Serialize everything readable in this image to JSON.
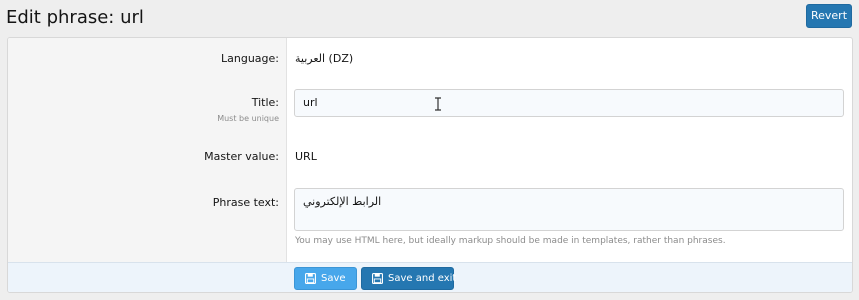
{
  "header": {
    "title": "Edit phrase: url",
    "revert_label": "Revert"
  },
  "form": {
    "language": {
      "label": "Language:",
      "value": "العربية (DZ)"
    },
    "title": {
      "label": "Title:",
      "hint": "Must be unique",
      "value": "url"
    },
    "master_value": {
      "label": "Master value:",
      "value": "URL"
    },
    "phrase_text": {
      "label": "Phrase text:",
      "value": "الرابط الإلكتروني",
      "explain": "You may use HTML here, but ideally markup should be made in templates, rather than phrases."
    }
  },
  "footer": {
    "save_label": "Save",
    "save_exit_label": "Save and exit"
  },
  "icons": {
    "save": "floppy-disk-icon",
    "cursor": "text-cursor-icon"
  },
  "colors": {
    "primary": "#2577b1",
    "secondary": "#47a7eb",
    "footer_bg": "#edf4fb",
    "input_bg": "#f7fafd"
  }
}
